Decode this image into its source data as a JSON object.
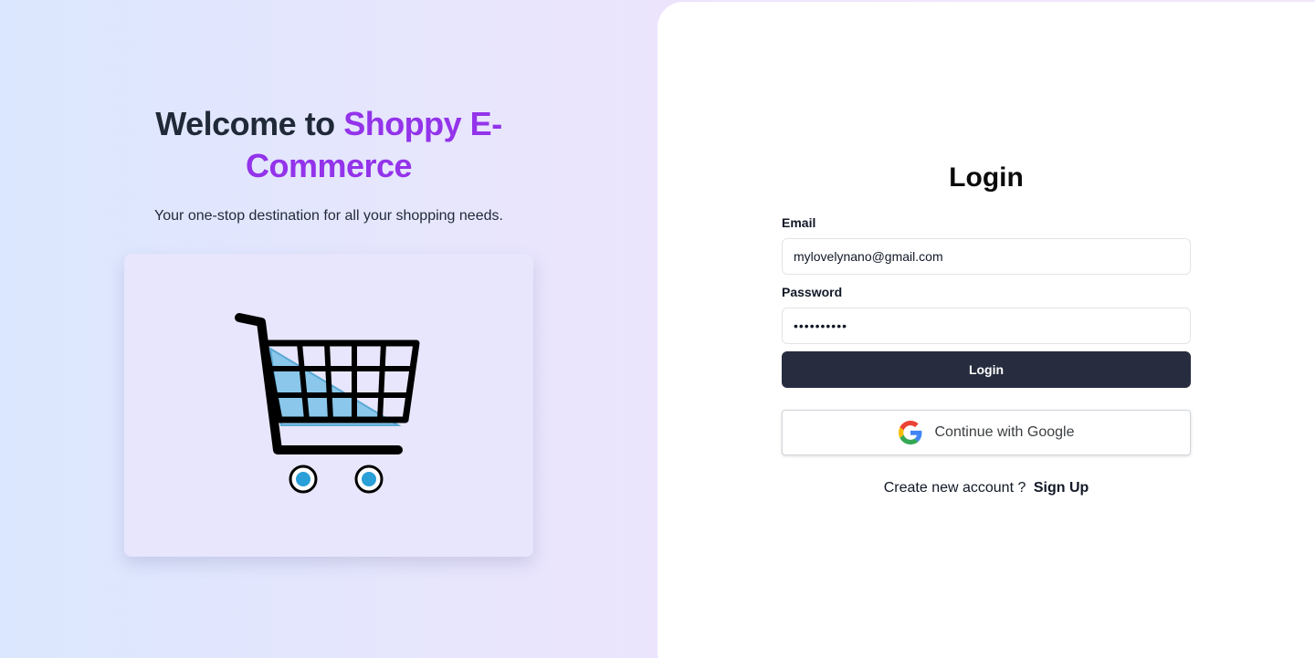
{
  "hero": {
    "welcome_prefix": "Welcome to ",
    "brand_name": "Shoppy E-Commerce",
    "tagline": "Your one-stop destination for all your shopping needs.",
    "illustration_icon": "shopping-cart-icon"
  },
  "login": {
    "title": "Login",
    "email_label": "Email",
    "email_value": "mylovelynano@gmail.com",
    "password_label": "Password",
    "password_value": "••••••••••",
    "submit_label": "Login",
    "google_label": "Continue with Google",
    "google_icon": "google-g-icon",
    "signup_prompt": "Create new account ?",
    "signup_link": "Sign Up"
  },
  "colors": {
    "brand": "#9333ea",
    "heading": "#1f2937",
    "button_dark": "#272d3f"
  }
}
